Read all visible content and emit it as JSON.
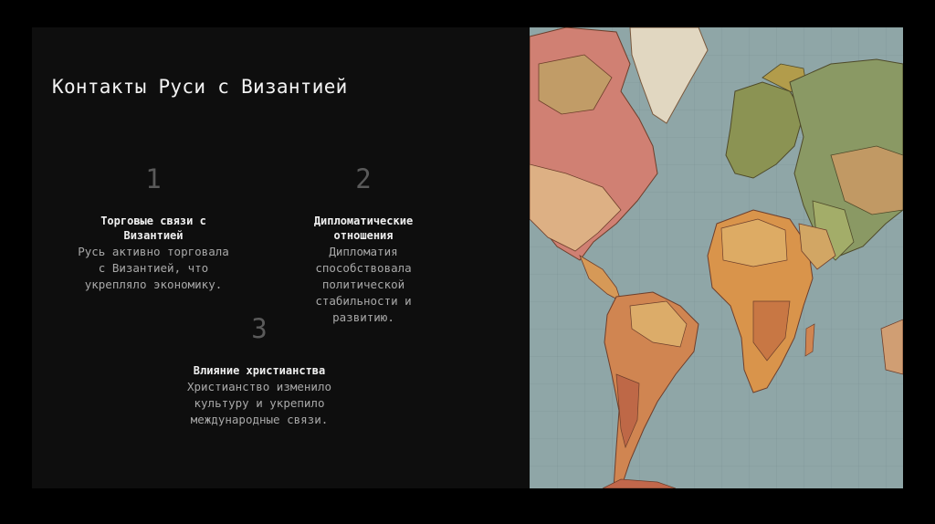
{
  "slide": {
    "title": "Контакты Руси с Византией",
    "items": [
      {
        "number": "1",
        "title": "Торговые связи с Византией",
        "text": "Русь активно торговала с Византией, что укрепляло экономику."
      },
      {
        "number": "2",
        "title": "Дипломатические отношения",
        "text": "Дипломатия способствовала политической стабильности и развитию."
      },
      {
        "number": "3",
        "title": "Влияние христианства",
        "text": "Христианство изменило культуру и укрепило международные связи."
      }
    ]
  },
  "map_image": {
    "description_icon": "world-map-image"
  },
  "colors": {
    "background": "#000000",
    "slide": "#0e0e0e",
    "ocean": "#8fa9ae"
  }
}
